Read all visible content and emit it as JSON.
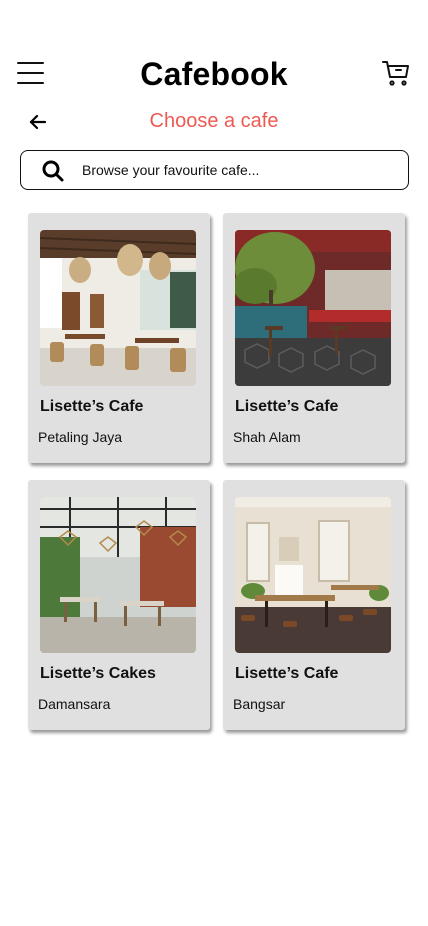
{
  "header": {
    "app_title": "Cafebook",
    "menu_icon": "hamburger-menu-icon",
    "cart_icon": "shopping-cart-icon"
  },
  "nav": {
    "back_icon": "arrow-left-icon",
    "heading": "Choose a cafe",
    "heading_color": "#ee5a52"
  },
  "search": {
    "placeholder": "Browse your favourite cafe...",
    "value": "",
    "icon": "search-icon"
  },
  "cafes": [
    {
      "name": "Lisette’s Cafe",
      "location": "Petaling Jaya"
    },
    {
      "name": "Lisette’s Cafe",
      "location": "Shah Alam"
    },
    {
      "name": "Lisette’s Cakes",
      "location": "Damansara"
    },
    {
      "name": "Lisette’s Cafe",
      "location": "Bangsar"
    }
  ]
}
